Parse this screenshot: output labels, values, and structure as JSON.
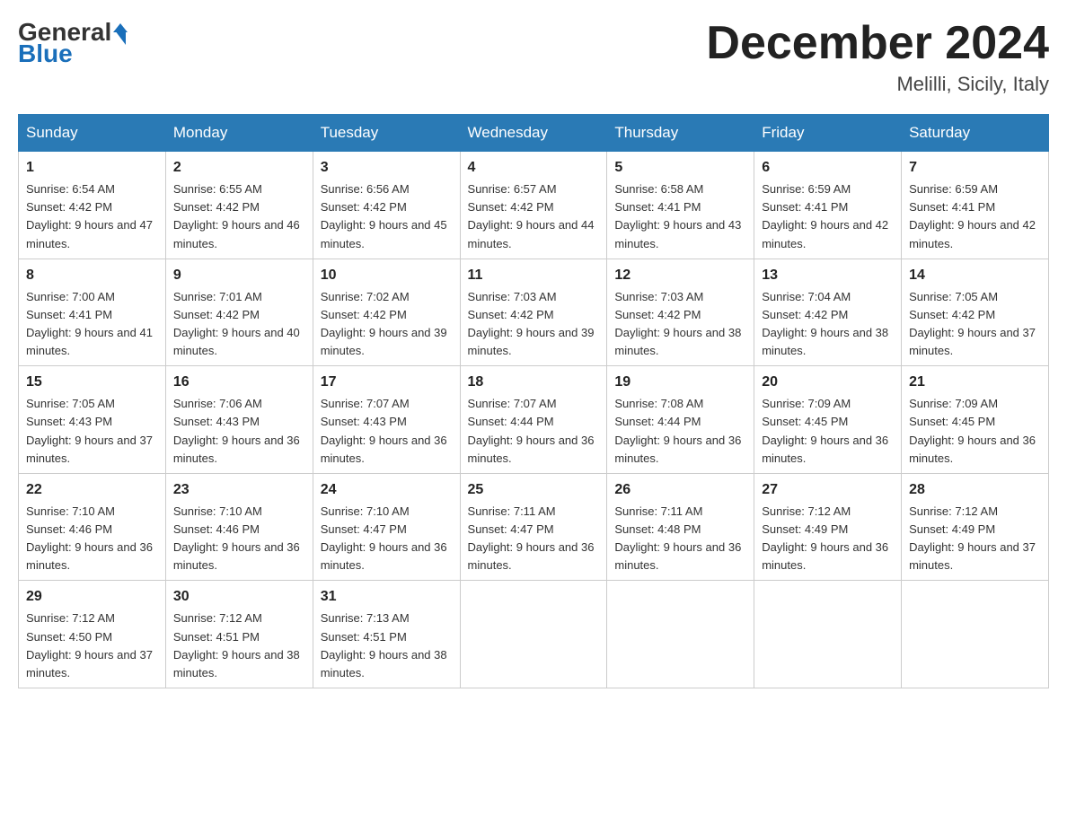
{
  "header": {
    "logo": {
      "general": "General",
      "blue": "Blue"
    },
    "title": "December 2024",
    "location": "Melilli, Sicily, Italy"
  },
  "days_of_week": [
    "Sunday",
    "Monday",
    "Tuesday",
    "Wednesday",
    "Thursday",
    "Friday",
    "Saturday"
  ],
  "weeks": [
    [
      {
        "day": "1",
        "sunrise": "6:54 AM",
        "sunset": "4:42 PM",
        "daylight": "9 hours and 47 minutes."
      },
      {
        "day": "2",
        "sunrise": "6:55 AM",
        "sunset": "4:42 PM",
        "daylight": "9 hours and 46 minutes."
      },
      {
        "day": "3",
        "sunrise": "6:56 AM",
        "sunset": "4:42 PM",
        "daylight": "9 hours and 45 minutes."
      },
      {
        "day": "4",
        "sunrise": "6:57 AM",
        "sunset": "4:42 PM",
        "daylight": "9 hours and 44 minutes."
      },
      {
        "day": "5",
        "sunrise": "6:58 AM",
        "sunset": "4:41 PM",
        "daylight": "9 hours and 43 minutes."
      },
      {
        "day": "6",
        "sunrise": "6:59 AM",
        "sunset": "4:41 PM",
        "daylight": "9 hours and 42 minutes."
      },
      {
        "day": "7",
        "sunrise": "6:59 AM",
        "sunset": "4:41 PM",
        "daylight": "9 hours and 42 minutes."
      }
    ],
    [
      {
        "day": "8",
        "sunrise": "7:00 AM",
        "sunset": "4:41 PM",
        "daylight": "9 hours and 41 minutes."
      },
      {
        "day": "9",
        "sunrise": "7:01 AM",
        "sunset": "4:42 PM",
        "daylight": "9 hours and 40 minutes."
      },
      {
        "day": "10",
        "sunrise": "7:02 AM",
        "sunset": "4:42 PM",
        "daylight": "9 hours and 39 minutes."
      },
      {
        "day": "11",
        "sunrise": "7:03 AM",
        "sunset": "4:42 PM",
        "daylight": "9 hours and 39 minutes."
      },
      {
        "day": "12",
        "sunrise": "7:03 AM",
        "sunset": "4:42 PM",
        "daylight": "9 hours and 38 minutes."
      },
      {
        "day": "13",
        "sunrise": "7:04 AM",
        "sunset": "4:42 PM",
        "daylight": "9 hours and 38 minutes."
      },
      {
        "day": "14",
        "sunrise": "7:05 AM",
        "sunset": "4:42 PM",
        "daylight": "9 hours and 37 minutes."
      }
    ],
    [
      {
        "day": "15",
        "sunrise": "7:05 AM",
        "sunset": "4:43 PM",
        "daylight": "9 hours and 37 minutes."
      },
      {
        "day": "16",
        "sunrise": "7:06 AM",
        "sunset": "4:43 PM",
        "daylight": "9 hours and 36 minutes."
      },
      {
        "day": "17",
        "sunrise": "7:07 AM",
        "sunset": "4:43 PM",
        "daylight": "9 hours and 36 minutes."
      },
      {
        "day": "18",
        "sunrise": "7:07 AM",
        "sunset": "4:44 PM",
        "daylight": "9 hours and 36 minutes."
      },
      {
        "day": "19",
        "sunrise": "7:08 AM",
        "sunset": "4:44 PM",
        "daylight": "9 hours and 36 minutes."
      },
      {
        "day": "20",
        "sunrise": "7:09 AM",
        "sunset": "4:45 PM",
        "daylight": "9 hours and 36 minutes."
      },
      {
        "day": "21",
        "sunrise": "7:09 AM",
        "sunset": "4:45 PM",
        "daylight": "9 hours and 36 minutes."
      }
    ],
    [
      {
        "day": "22",
        "sunrise": "7:10 AM",
        "sunset": "4:46 PM",
        "daylight": "9 hours and 36 minutes."
      },
      {
        "day": "23",
        "sunrise": "7:10 AM",
        "sunset": "4:46 PM",
        "daylight": "9 hours and 36 minutes."
      },
      {
        "day": "24",
        "sunrise": "7:10 AM",
        "sunset": "4:47 PM",
        "daylight": "9 hours and 36 minutes."
      },
      {
        "day": "25",
        "sunrise": "7:11 AM",
        "sunset": "4:47 PM",
        "daylight": "9 hours and 36 minutes."
      },
      {
        "day": "26",
        "sunrise": "7:11 AM",
        "sunset": "4:48 PM",
        "daylight": "9 hours and 36 minutes."
      },
      {
        "day": "27",
        "sunrise": "7:12 AM",
        "sunset": "4:49 PM",
        "daylight": "9 hours and 36 minutes."
      },
      {
        "day": "28",
        "sunrise": "7:12 AM",
        "sunset": "4:49 PM",
        "daylight": "9 hours and 37 minutes."
      }
    ],
    [
      {
        "day": "29",
        "sunrise": "7:12 AM",
        "sunset": "4:50 PM",
        "daylight": "9 hours and 37 minutes."
      },
      {
        "day": "30",
        "sunrise": "7:12 AM",
        "sunset": "4:51 PM",
        "daylight": "9 hours and 38 minutes."
      },
      {
        "day": "31",
        "sunrise": "7:13 AM",
        "sunset": "4:51 PM",
        "daylight": "9 hours and 38 minutes."
      },
      null,
      null,
      null,
      null
    ]
  ]
}
